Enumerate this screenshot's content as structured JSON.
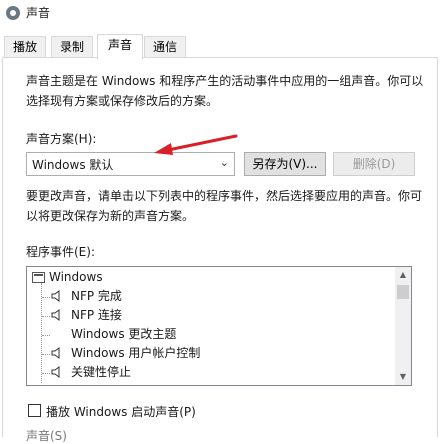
{
  "window": {
    "title": "声音"
  },
  "tabs": [
    {
      "label": "播放"
    },
    {
      "label": "录制"
    },
    {
      "label": "声音",
      "active": true
    },
    {
      "label": "通信"
    }
  ],
  "description": {
    "line1": "声音主题是在 Windows 和程序产生的活动事件中应用的一组声音。你可以",
    "line2": "选择现有方案或保存修改后的方案。"
  },
  "scheme": {
    "label": "声音方案(H):",
    "selected": "Windows 默认",
    "save_as_button": "另存为(V)...",
    "delete_button": "删除(D)"
  },
  "instructions": {
    "line1": "要更改声音，请单击以下列表中的程序事件，然后选择要应用的声音。你可",
    "line2": "以将更改保存为新的声音方案。"
  },
  "events": {
    "label": "程序事件(E):",
    "items": [
      {
        "label": "Windows",
        "level": 0,
        "icon": "windows-group-icon"
      },
      {
        "label": "NFP 完成",
        "level": 1,
        "icon": "speaker-icon"
      },
      {
        "label": "NFP 连接",
        "level": 1,
        "icon": "speaker-icon"
      },
      {
        "label": "Windows 更改主题",
        "level": 1,
        "icon": "none"
      },
      {
        "label": "Windows 用户帐户控制",
        "level": 1,
        "icon": "speaker-icon"
      },
      {
        "label": "关键性停止",
        "level": 1,
        "icon": "speaker-icon"
      }
    ]
  },
  "startup_sound": {
    "label": "播放 Windows 启动声音(P)",
    "checked": false
  },
  "sounds_label": "声音(S)",
  "colors": {
    "annotation_arrow": "#d8202a"
  }
}
